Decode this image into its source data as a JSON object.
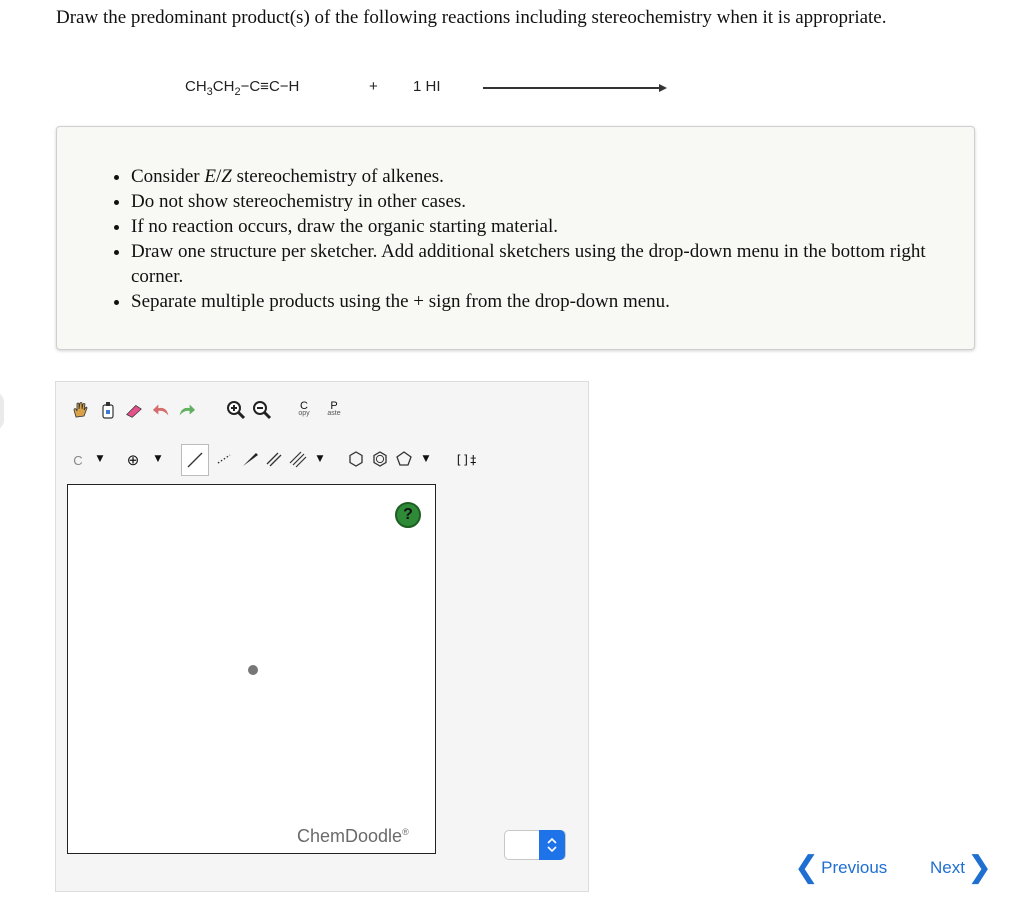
{
  "question": {
    "prompt": "Draw the predominant product(s) of the following reactions including stereochemistry when it is appropriate."
  },
  "reaction": {
    "reactant_parts": [
      "CH",
      "3",
      "CH",
      "2",
      "−C≡C−H"
    ],
    "plus": "+",
    "reagent": "1 HI"
  },
  "instructions": {
    "items": [
      [
        "Consider ",
        "E",
        "/",
        "Z",
        " stereochemistry of alkenes."
      ],
      [
        "Do not show stereochemistry in other cases."
      ],
      [
        "If no reaction occurs, draw the organic starting material."
      ],
      [
        "Draw one structure per sketcher. Add additional sketchers using the drop-down menu in the bottom right corner."
      ],
      [
        "Separate multiple products using the + sign from the drop-down menu."
      ]
    ]
  },
  "toolbar": {
    "copy_c": "C",
    "copy_rest": "opy",
    "paste_p": "P",
    "paste_rest": "aste",
    "atom_label": "C",
    "charge_label": "⊕",
    "bracket_label": "[]‡"
  },
  "sketcher": {
    "help_label": "?",
    "brand": "ChemDoodle",
    "brand_mark": "®"
  },
  "nav": {
    "previous": "Previous",
    "next": "Next"
  },
  "colors": {
    "accent": "#1f73e8",
    "help": "#2f8a37",
    "link": "#1f6fd1"
  }
}
